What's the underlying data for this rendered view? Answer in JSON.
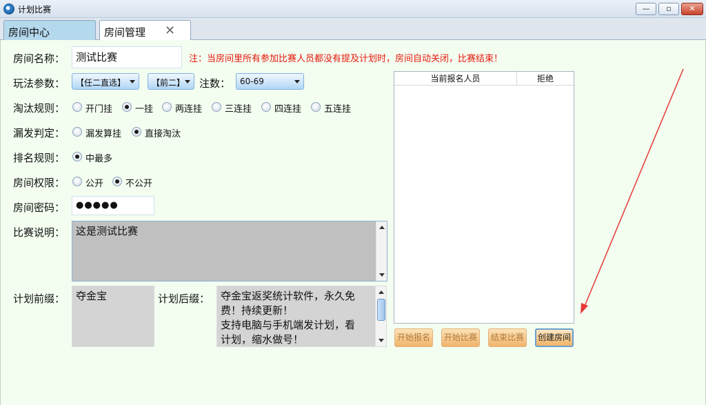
{
  "window": {
    "title": "计划比赛",
    "min": "—",
    "max": "▫",
    "close": "✕"
  },
  "tabs": [
    {
      "label": "房间中心"
    },
    {
      "label": "房间管理",
      "close": "✕"
    }
  ],
  "form": {
    "room_name": {
      "label": "房间名称：",
      "value": "测试比赛"
    },
    "notice": "注：当房间里所有参加比赛人员都没有提及计划时，房间自动关闭，比赛结束！",
    "play": {
      "label": "玩法参数：",
      "dd1": "【任二直选】",
      "dd2": "【前二】",
      "bet_label": "注数：",
      "dd3": "60-69"
    },
    "elimination": {
      "label": "淘汰规则：",
      "options": [
        "开门挂",
        "一挂",
        "两连挂",
        "三连挂",
        "四连挂",
        "五连挂"
      ],
      "selected": "一挂"
    },
    "miss": {
      "label": "漏发判定：",
      "options": [
        "漏发算挂",
        "直接淘汰"
      ],
      "selected": "直接淘汰"
    },
    "ranking": {
      "label": "排名规则：",
      "options": [
        "中最多"
      ],
      "selected": "中最多"
    },
    "permission": {
      "label": "房间权限：",
      "options": [
        "公开",
        "不公开"
      ],
      "selected": "不公开"
    },
    "password": {
      "label": "房间密码：",
      "value": "●●●●●"
    },
    "description": {
      "label": "比赛说明：",
      "value": "这是测试比赛"
    },
    "prefix": {
      "label": "计划前缀：",
      "value": "夺金宝"
    },
    "suffix": {
      "label": "计划后缀：",
      "lines": [
        "夺金宝返奖统计软件，永久免",
        "费！持续更新！",
        "支持电脑与手机端发计划，看",
        "计划，缩水做号！"
      ]
    }
  },
  "list": {
    "headers": [
      "当前报名人员",
      "拒绝"
    ]
  },
  "buttons": {
    "start_signup": "开始报名",
    "start_match": "开始比赛",
    "end_match": "结束比赛",
    "create_room": "创建房间"
  },
  "colors": {
    "notice": "#e8190d",
    "arrow": "#e53935",
    "background": "#f3fdf0"
  }
}
